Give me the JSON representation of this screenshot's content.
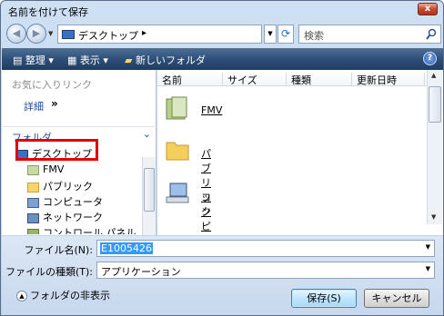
{
  "window": {
    "title": "名前を付けて保存",
    "close_label": "x"
  },
  "address": {
    "path": "デスクトップ",
    "chevron": "▸",
    "search_placeholder": "検索"
  },
  "toolbar": {
    "organize": "整理",
    "views": "表示",
    "new_folder": "新しいフォルダ",
    "help": "?"
  },
  "leftpane": {
    "favorites": "お気に入りリンク",
    "details": "詳細",
    "details_arrow": "»",
    "folders": "フォルダ",
    "folders_chevron": "⌄",
    "tree": [
      {
        "label": "デスクトップ",
        "icon": "desktop-icon"
      },
      {
        "label": "FMV",
        "icon": "user-folder-icon"
      },
      {
        "label": "パブリック",
        "icon": "folder-icon"
      },
      {
        "label": "コンピュータ",
        "icon": "computer-icon"
      },
      {
        "label": "ネットワーク",
        "icon": "network-icon"
      },
      {
        "label": "コントロール パネル",
        "icon": "control-panel-icon"
      }
    ]
  },
  "columns": [
    "名前",
    "サイズ",
    "種類",
    "更新日時"
  ],
  "files": [
    {
      "name": "FMV",
      "icon": "user-folder-icon"
    },
    {
      "name": "パブリック",
      "icon": "folder-icon"
    },
    {
      "name": "コンピュータ",
      "icon": "computer-icon"
    }
  ],
  "form": {
    "filename_label": "ファイル名(N):",
    "filename_value": "E1005426",
    "filetype_label": "ファイルの種類(T):",
    "filetype_value": "アプリケーション",
    "hide_folders": "フォルダの非表示",
    "save": "保存(S)",
    "cancel": "キャンセル"
  },
  "colors": {
    "toolbar": "#2d4f78",
    "highlight": "#e00000",
    "selection": "#3399ff"
  }
}
